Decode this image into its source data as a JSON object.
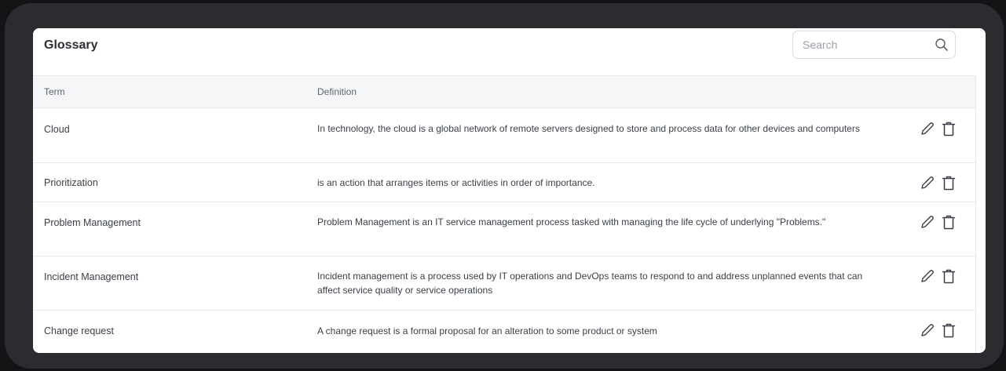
{
  "glossary": {
    "title": "Glossary",
    "search": {
      "placeholder": "Search",
      "value": ""
    },
    "columns": {
      "term": "Term",
      "definition": "Definition"
    },
    "rows": [
      {
        "term": "Cloud",
        "definition": "In technology, the cloud is a global network of remote servers designed to store and process data for other devices and computers"
      },
      {
        "term": "Prioritization",
        "definition": "is an action that arranges items or activities in order of importance."
      },
      {
        "term": "Problem Management",
        "definition": "Problem Management is an IT service management process tasked with managing the life cycle of underlying \"Problems.\""
      },
      {
        "term": "Incident Management",
        "definition": "Incident management is a process used by IT operations and DevOps teams to respond to and address unplanned events that can affect service quality or service operations"
      },
      {
        "term": "Change request",
        "definition": "A change request is a formal proposal for an alteration to some product or system"
      }
    ],
    "row_actions": {
      "edit_icon": "pencil-icon",
      "delete_icon": "trash-icon"
    }
  },
  "colors": {
    "page_background": "#131416",
    "frame": "#2b2c2f",
    "card": "#ffffff",
    "header_row": "#f4f6f8",
    "text": "#3a3f47"
  }
}
